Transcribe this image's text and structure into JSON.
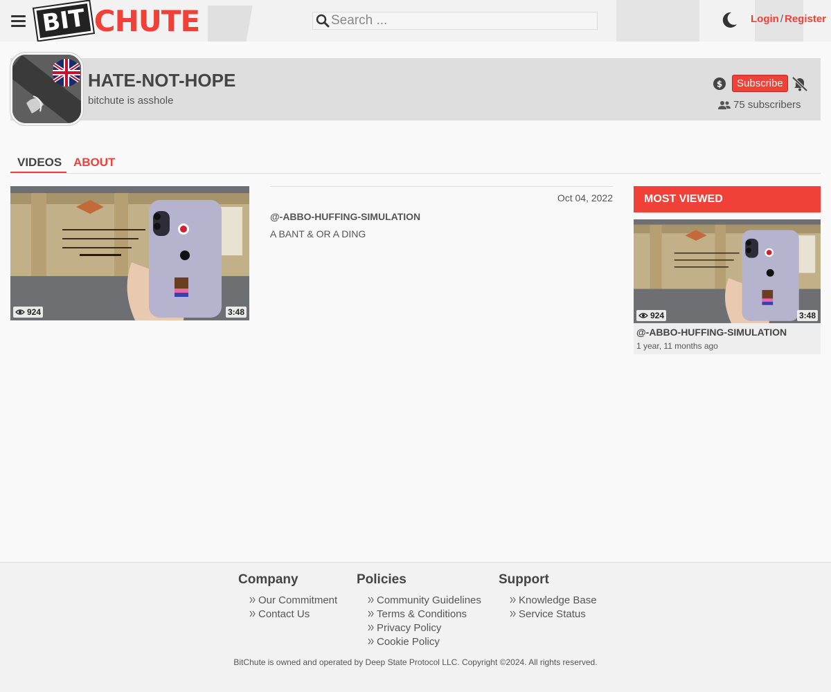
{
  "header": {
    "logo_bit": "BIT",
    "logo_chute": "CHUTE",
    "search_placeholder": "Search ...",
    "login": "Login",
    "separator": "/",
    "register": "Register"
  },
  "channel": {
    "name": "HATE-NOT-HOPE",
    "description": "bitchute is asshole",
    "subscribe_label": "Subscribe",
    "subscribers": "75 subscribers"
  },
  "tabs": [
    {
      "label": "VIDEOS"
    },
    {
      "label": "ABOUT"
    }
  ],
  "video": {
    "views": "924",
    "duration": "3:48",
    "date": "Oct 04, 2022",
    "title": "@-ABBO-HUFFING-SIMULATION",
    "description": "A BANT & OR A DING"
  },
  "most_viewed": {
    "heading": "MOST VIEWED",
    "views": "924",
    "duration": "3:48",
    "title": "@-ABBO-HUFFING-SIMULATION",
    "time_ago": "1 year, 11 months ago"
  },
  "footer": {
    "columns": [
      {
        "heading": "Company",
        "links": [
          "Our Commitment",
          "Contact Us"
        ]
      },
      {
        "heading": "Policies",
        "links": [
          "Community Guidelines",
          "Terms & Conditions",
          "Privacy Policy",
          "Cookie Policy"
        ]
      },
      {
        "heading": "Support",
        "links": [
          "Knowledge Base",
          "Service Status"
        ]
      }
    ],
    "copyright": "BitChute is owned and operated by Deep State Protocol LLC. Copyright ©2024. All rights reserved."
  },
  "colors": {
    "accent": "#ef4137",
    "background": "#f9f9f9",
    "banner": "#dedede"
  },
  "icons": [
    "hamburger-icon",
    "search-icon",
    "moon-icon",
    "dollar-icon",
    "bell-slash-icon",
    "users-icon",
    "eye-icon",
    "chevron-double-right-icon"
  ]
}
